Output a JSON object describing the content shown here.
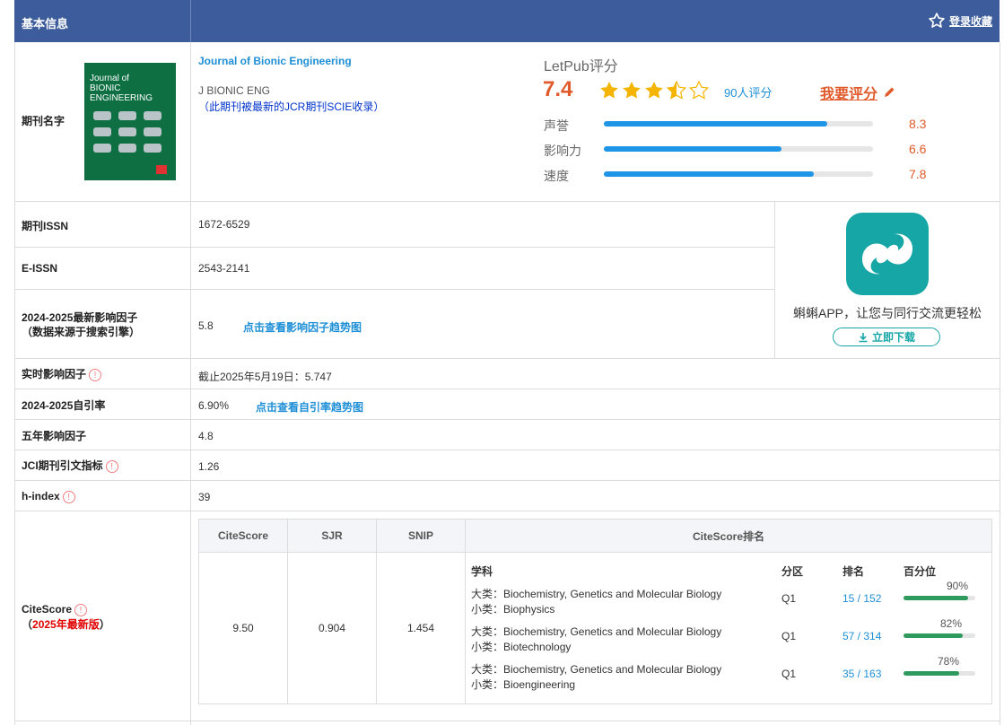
{
  "header": {
    "title": "基本信息",
    "favorite_label": "登录收藏"
  },
  "journal": {
    "row_label": "期刊名字",
    "full_name": "Journal of Bionic Engineering",
    "abbr": "J BIONIC ENG",
    "note": "（此期刊被最新的JCR期刊SCIE收录）",
    "cover_title": [
      "Journal of",
      "BIONIC",
      "ENGINEERING"
    ]
  },
  "rating": {
    "title": "LetPub评分",
    "score": "7.4",
    "stars": 3.5,
    "count_label": "90人评分",
    "rate_me": "我要评分",
    "items": [
      {
        "label": "声誉",
        "value": "8.3",
        "fraction": 0.83
      },
      {
        "label": "影响力",
        "value": "6.6",
        "fraction": 0.66
      },
      {
        "label": "速度",
        "value": "7.8",
        "fraction": 0.78
      }
    ]
  },
  "app": {
    "text": "蝌蝌APP，让您与同行交流更轻松",
    "download": "立即下载"
  },
  "rows": {
    "issn": {
      "label": "期刊ISSN",
      "value": "1672-6529"
    },
    "eissn": {
      "label": "E-ISSN",
      "value": "2543-2141"
    },
    "if": {
      "label1": "2024-2025最新影响因子",
      "label2": "（数据来源于搜索引擎）",
      "value": "5.8",
      "link": "点击查看影响因子趋势图"
    },
    "realtime": {
      "label": "实时影响因子",
      "value": "截止2025年5月19日：5.747"
    },
    "selfcite": {
      "label": "2024-2025自引率",
      "value": "6.90%",
      "link": "点击查看自引率趋势图"
    },
    "five_year": {
      "label": "五年影响因子",
      "value": "4.8"
    },
    "jci": {
      "label": "JCI期刊引文指标",
      "value": "1.26"
    },
    "hindex": {
      "label": "h-index",
      "value": "39"
    },
    "citescore": {
      "label": "CiteScore",
      "label2_pre": "（",
      "label2_em": "2025年最新版",
      "label2_post": "）"
    }
  },
  "citescore_table": {
    "headers": [
      "CiteScore",
      "SJR",
      "SNIP",
      "CiteScore排名"
    ],
    "values": [
      "9.50",
      "0.904",
      "1.454"
    ],
    "rank_headers": {
      "subject": "学科",
      "zone": "分区",
      "rank": "排名",
      "percentile": "百分位"
    },
    "ranks": [
      {
        "major": "大类：Biochemistry, Genetics and Molecular Biology",
        "minor": "小类：Biophysics",
        "zone": "Q1",
        "rank": "15 / 152",
        "pct_label": "90%",
        "pct": 0.9
      },
      {
        "major": "大类：Biochemistry, Genetics and Molecular Biology",
        "minor": "小类：Biotechnology",
        "zone": "Q1",
        "rank": "57 / 314",
        "pct_label": "82%",
        "pct": 0.82
      },
      {
        "major": "大类：Biochemistry, Genetics and Molecular Biology",
        "minor": "小类：Bioengineering",
        "zone": "Q1",
        "rank": "35 / 163",
        "pct_label": "78%",
        "pct": 0.78
      }
    ]
  },
  "colors": {
    "header": "#3d5c9b",
    "link": "#1e8fd6",
    "score": "#e05a2b",
    "bar": "#1e95e6",
    "pct_bar": "#2e9a5e",
    "app": "#17a6a6"
  }
}
